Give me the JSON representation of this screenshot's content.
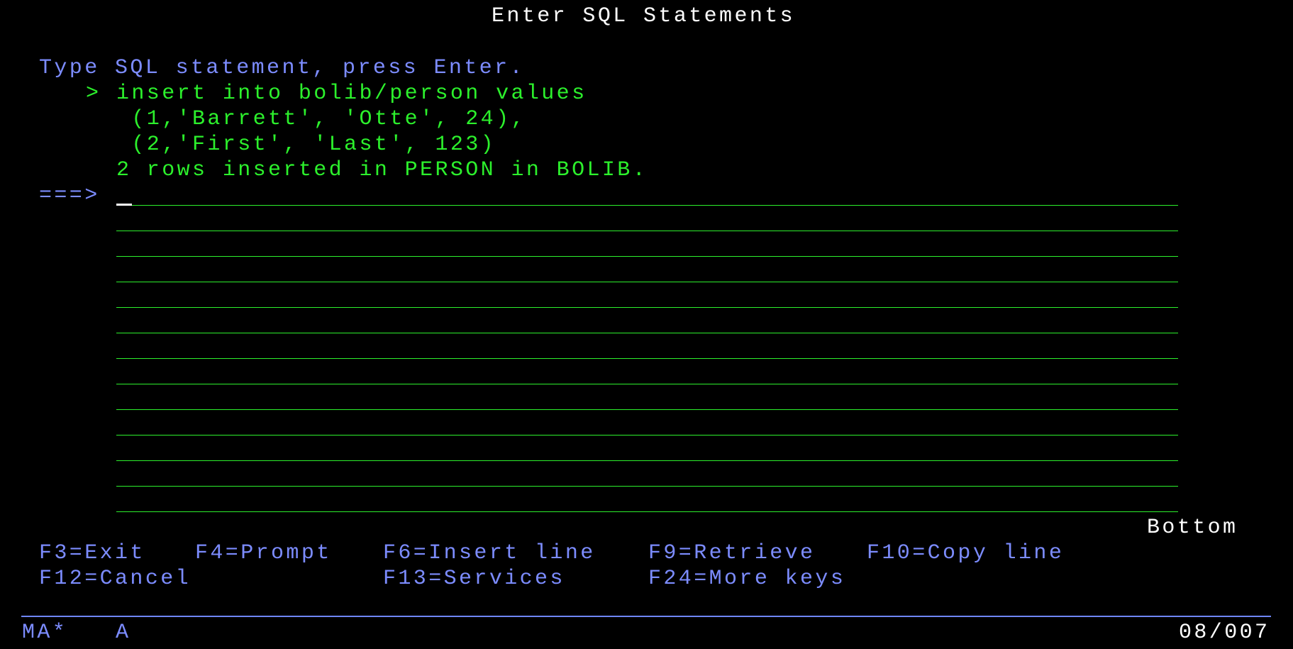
{
  "screen": {
    "title": "Enter SQL Statements",
    "instruction": "Type SQL statement, press Enter.",
    "prior_marker": ">",
    "prior_statement": [
      "insert into bolib/person values",
      " (1,'Barrett', 'Otte', 24),",
      " (2,'First', 'Last', 123)"
    ],
    "result_message": "2 rows inserted in PERSON in BOLIB.",
    "command_prompt": "===>",
    "input_lines": [
      "",
      "",
      "",
      "",
      "",
      "",
      "",
      "",
      "",
      "",
      "",
      "",
      ""
    ],
    "scroll_indicator": "Bottom"
  },
  "function_keys": {
    "f3": "F3=Exit",
    "f4": "F4=Prompt",
    "f6": "F6=Insert line",
    "f9": "F9=Retrieve",
    "f10": "F10=Copy line",
    "f12": "F12=Cancel",
    "f13": "F13=Services",
    "f24": "F24=More keys"
  },
  "status_bar": {
    "session": "MA*",
    "mode": "A",
    "cursor_position": "08/007"
  },
  "colors": {
    "background": "#000000",
    "title": "#ffffff",
    "info_text": "#7c8cff",
    "entry_text": "#2cf02c"
  }
}
